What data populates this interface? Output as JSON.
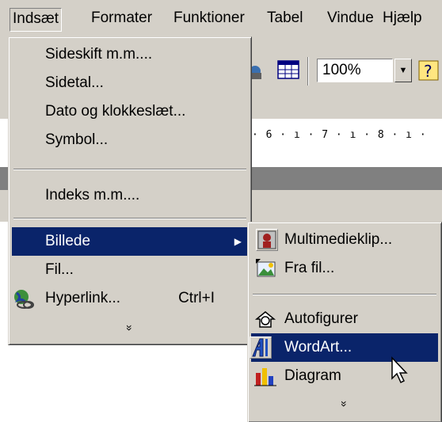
{
  "menubar": {
    "items": [
      {
        "label": "Indsæt",
        "active": true
      },
      {
        "label": "Formater"
      },
      {
        "label": "Funktioner"
      },
      {
        "label": "Tabel"
      },
      {
        "label": "Vindue"
      },
      {
        "label": "Hjælp"
      }
    ]
  },
  "toolbar": {
    "zoom_value": "100%",
    "ruler_text": "· 6 · ı · 7 · ı · 8 · ı ·"
  },
  "insert_menu": {
    "items": [
      {
        "label": "Sideskift m.m...."
      },
      {
        "label": "Sidetal..."
      },
      {
        "label": "Dato og klokkeslæt..."
      },
      {
        "label": "Symbol..."
      },
      {
        "label": "Indeks m.m...."
      },
      {
        "label": "Billede",
        "highlighted": true,
        "submenu": true
      },
      {
        "label": "Fil..."
      },
      {
        "label": "Hyperlink...",
        "shortcut": "Ctrl+I",
        "icon": "hyperlink-globe-icon"
      }
    ],
    "more_symbol": "»"
  },
  "picture_submenu": {
    "items": [
      {
        "label": "Multimedieklip...",
        "icon": "clipart-icon"
      },
      {
        "label": "Fra fil...",
        "icon": "picture-from-file-icon"
      },
      {
        "label": "Autofigurer",
        "icon": "autoshapes-icon"
      },
      {
        "label": "WordArt...",
        "icon": "wordart-icon",
        "highlighted": true
      },
      {
        "label": "Diagram",
        "icon": "chart-icon"
      }
    ],
    "more_symbol": "»"
  },
  "colors": {
    "menu_face": "#d4d0c8",
    "highlight": "#0a246a",
    "highlight_text": "#ffffff"
  }
}
